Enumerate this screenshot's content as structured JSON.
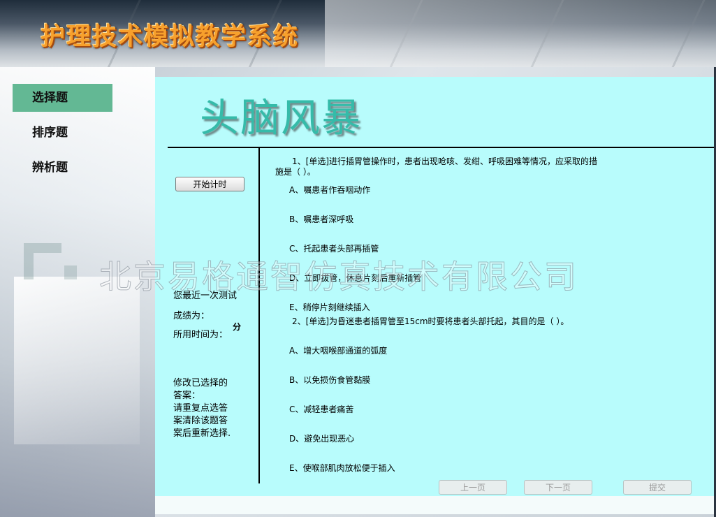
{
  "app": {
    "title": "护理技术模拟教学系统"
  },
  "sidebar": {
    "items": [
      {
        "label": "选择题",
        "active": true
      },
      {
        "label": "排序题",
        "active": false
      },
      {
        "label": "辨析题",
        "active": false
      }
    ]
  },
  "main": {
    "title": "头脑风暴",
    "timer_button": "开始计时",
    "last_test_label": "您最近一次测试",
    "score_label": "成绩为：",
    "time_label": "所用时间为：",
    "time_unit": "分",
    "hint": [
      "修改已选择的",
      "答案：",
      "请重复点选答",
      "案清除该题答",
      "案后重新选择."
    ],
    "questions": [
      {
        "stem": "1、[单选]进行插胃管操作时，患者出现呛咳、发绀、呼吸困难等情况，应采取的措施是（ ）。",
        "options": [
          "A、嘱患者作吞咽动作",
          "B、嘱患者深呼吸",
          "C、托起患者头部再插管",
          "D、立即拔管，休息片刻后重新插管",
          "E、稍停片刻继续插入"
        ]
      },
      {
        "stem": "2、[单选]为昏迷患者插胃管至15cm时要将患者头部托起，其目的是（ ）。",
        "options": [
          "A、增大咽喉部通道的弧度",
          "B、以免损伤食管黏膜",
          "C、减轻患者痛苦",
          "D、避免出现恶心",
          "E、使喉部肌肉放松便于插入"
        ]
      }
    ],
    "buttons": {
      "prev": "上一页",
      "next": "下一页",
      "submit": "提交"
    }
  },
  "watermark": "北京易格通智仿真技术有限公司",
  "colors": {
    "panel": "#b8fcfc",
    "active_tab": "#63b894",
    "title": "#35bba9",
    "app_title": "#f7a02c"
  }
}
